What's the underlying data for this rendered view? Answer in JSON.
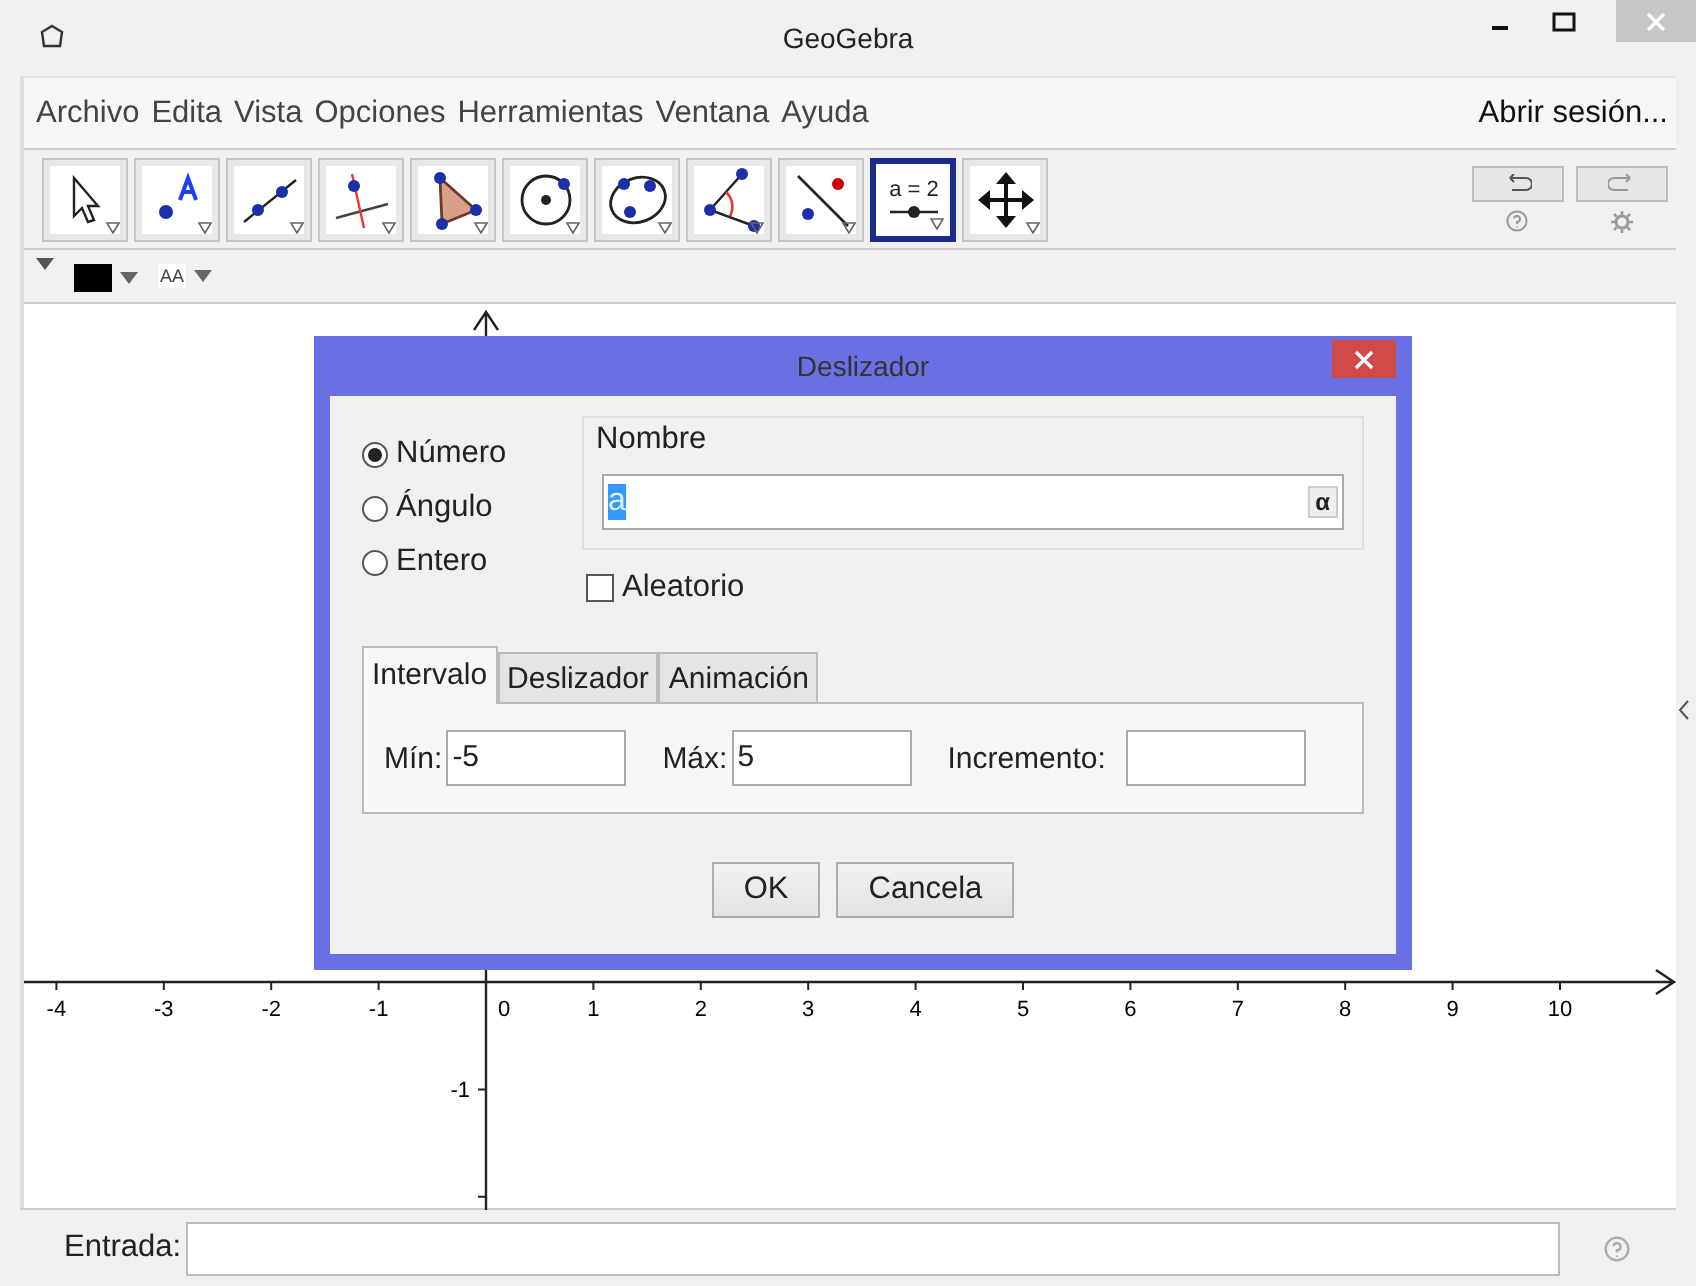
{
  "window": {
    "title": "GeoGebra"
  },
  "menu": [
    "Archivo",
    "Edita",
    "Vista",
    "Opciones",
    "Herramientas",
    "Ventana",
    "Ayuda"
  ],
  "sign_in": "Abrir sesión...",
  "tools": [
    {
      "kind": "move",
      "selected": false
    },
    {
      "kind": "point",
      "selected": false
    },
    {
      "kind": "line",
      "selected": false
    },
    {
      "kind": "perpendicular",
      "selected": false
    },
    {
      "kind": "polygon",
      "selected": false
    },
    {
      "kind": "circle",
      "selected": false
    },
    {
      "kind": "conic",
      "selected": false
    },
    {
      "kind": "angle",
      "selected": false
    },
    {
      "kind": "reflect",
      "selected": false
    },
    {
      "kind": "slider",
      "selected": true,
      "label": "a = 2"
    },
    {
      "kind": "move_view",
      "selected": false
    }
  ],
  "style_bar": {
    "color": "#000000",
    "text_size": "AA"
  },
  "graphics": {
    "x_labels": [
      "-4",
      "-3",
      "-2",
      "-1",
      "0",
      "1",
      "2",
      "3",
      "4",
      "5",
      "6",
      "7",
      "8",
      "9",
      "10"
    ],
    "y_labels": [
      "-1"
    ]
  },
  "dialog": {
    "title": "Deslizador",
    "types": [
      {
        "label": "Número",
        "selected": true
      },
      {
        "label": "Ángulo",
        "selected": false
      },
      {
        "label": "Entero",
        "selected": false
      }
    ],
    "name_legend": "Nombre",
    "name_value": "a",
    "name_text_selected": true,
    "alpha_button": "α",
    "random": {
      "label": "Aleatorio",
      "checked": false
    },
    "tabs": [
      {
        "label": "Intervalo",
        "selected": true
      },
      {
        "label": "Deslizador",
        "selected": false
      },
      {
        "label": "Animación",
        "selected": false
      }
    ],
    "fields": [
      {
        "label": "Mín:",
        "value": "-5"
      },
      {
        "label": "Máx:",
        "value": "5"
      },
      {
        "label": "Incremento:"
      }
    ],
    "buttons": [
      "OK",
      "Cancela"
    ]
  },
  "input_bar": {
    "label": "Entrada:"
  }
}
